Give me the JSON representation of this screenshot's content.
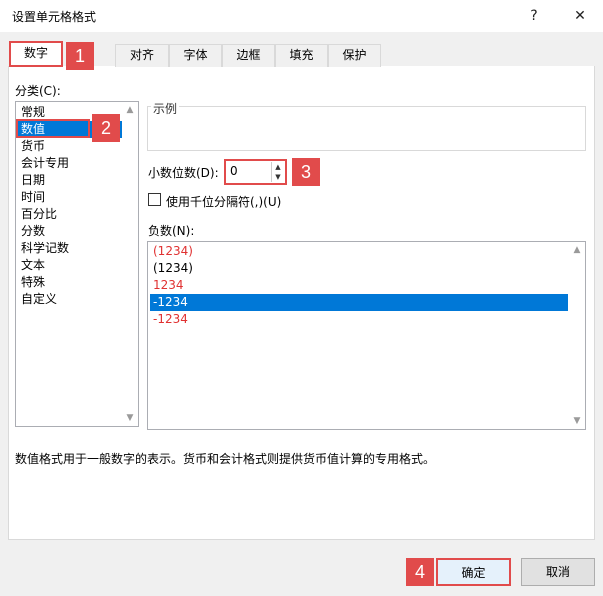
{
  "window": {
    "title": "设置单元格格式",
    "help_glyph": "?",
    "close_glyph": "✕"
  },
  "tabs": [
    {
      "label": "数字"
    },
    {
      "label": "对齐"
    },
    {
      "label": "字体"
    },
    {
      "label": "边框"
    },
    {
      "label": "填充"
    },
    {
      "label": "保护"
    }
  ],
  "callouts": [
    "1",
    "2",
    "3",
    "4"
  ],
  "category": {
    "label": "分类(C):",
    "items": [
      "常规",
      "数值",
      "货币",
      "会计专用",
      "日期",
      "时间",
      "百分比",
      "分数",
      "科学记数",
      "文本",
      "特殊",
      "自定义"
    ],
    "selected": "数值"
  },
  "sample": {
    "label": "示例"
  },
  "decimals": {
    "label": "小数位数(D):",
    "value": "0"
  },
  "thousands": {
    "label": "使用千位分隔符(,)(U)",
    "checked": false
  },
  "negative": {
    "label": "负数(N):",
    "items": [
      {
        "text": "(1234)",
        "color": "#e03131"
      },
      {
        "text": "(1234)",
        "color": "#000000"
      },
      {
        "text": "1234",
        "color": "#e03131"
      },
      {
        "text": "-1234",
        "color": "#000000",
        "selected": true
      },
      {
        "text": "-1234",
        "color": "#e03131"
      }
    ]
  },
  "description": "数值格式用于一般数字的表示。货币和会计格式则提供货币值计算的专用格式。",
  "buttons": {
    "ok": "确定",
    "cancel": "取消"
  },
  "colors": {
    "accent": "#0078d7",
    "callout": "#e14b4b"
  }
}
